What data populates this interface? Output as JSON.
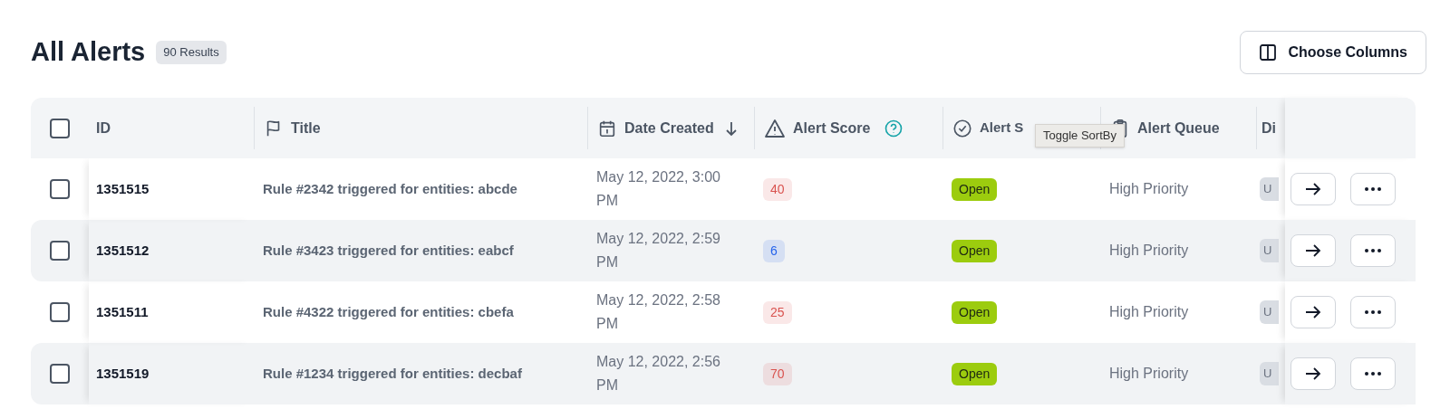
{
  "page": {
    "title": "All Alerts",
    "results_badge": "90 Results",
    "choose_columns_button": "Choose Columns"
  },
  "table": {
    "select_all": {
      "checked": false
    },
    "columns": [
      {
        "label": "ID",
        "sorted": false,
        "help": false
      },
      {
        "label": "Title",
        "sorted": false,
        "help": false
      },
      {
        "label": "Date Created",
        "sorted": true,
        "help": false
      },
      {
        "label": "Alert Score",
        "sorted": false,
        "help": true
      },
      {
        "label": "Alert S",
        "sorted": false,
        "help": false
      },
      {
        "label": "Alert Queue",
        "sorted": false,
        "help": false
      },
      {
        "label": "Di",
        "sorted": false,
        "help": false
      }
    ],
    "rows": [
      {
        "checked": false,
        "id": "1351515",
        "title": "Rule #2342 triggered for entities: abcde",
        "date": "May 12, 2022, 3:00 PM",
        "score": "40",
        "color": "#d9534f",
        "status": "Open",
        "queue": "High Priority",
        "column_8": "U"
      },
      {
        "checked": false,
        "id": "1351512",
        "title": "Rule #3423 triggered for entities: eabcf",
        "date": "May 12, 2022, 2:59 PM",
        "score": "6",
        "color": "#2563eb",
        "status": "Open",
        "queue": "High Priority",
        "column_8": "U"
      },
      {
        "checked": false,
        "id": "1351511",
        "title": "Rule #4322 triggered for entities: cbefa",
        "date": "May 12, 2022, 2:58 PM",
        "score": "25",
        "color": "#d9534f",
        "status": "Open",
        "queue": "High Priority",
        "column_8": "U"
      },
      {
        "checked": false,
        "id": "1351519",
        "title": "Rule #1234 triggered for entities: decbaf",
        "date": "May 12, 2022, 2:56 PM",
        "score": "70",
        "color": "#d9534f",
        "status": "Open",
        "queue": "High Priority",
        "column_8": "U"
      }
    ]
  },
  "tooltip": "Toggle SortBy"
}
